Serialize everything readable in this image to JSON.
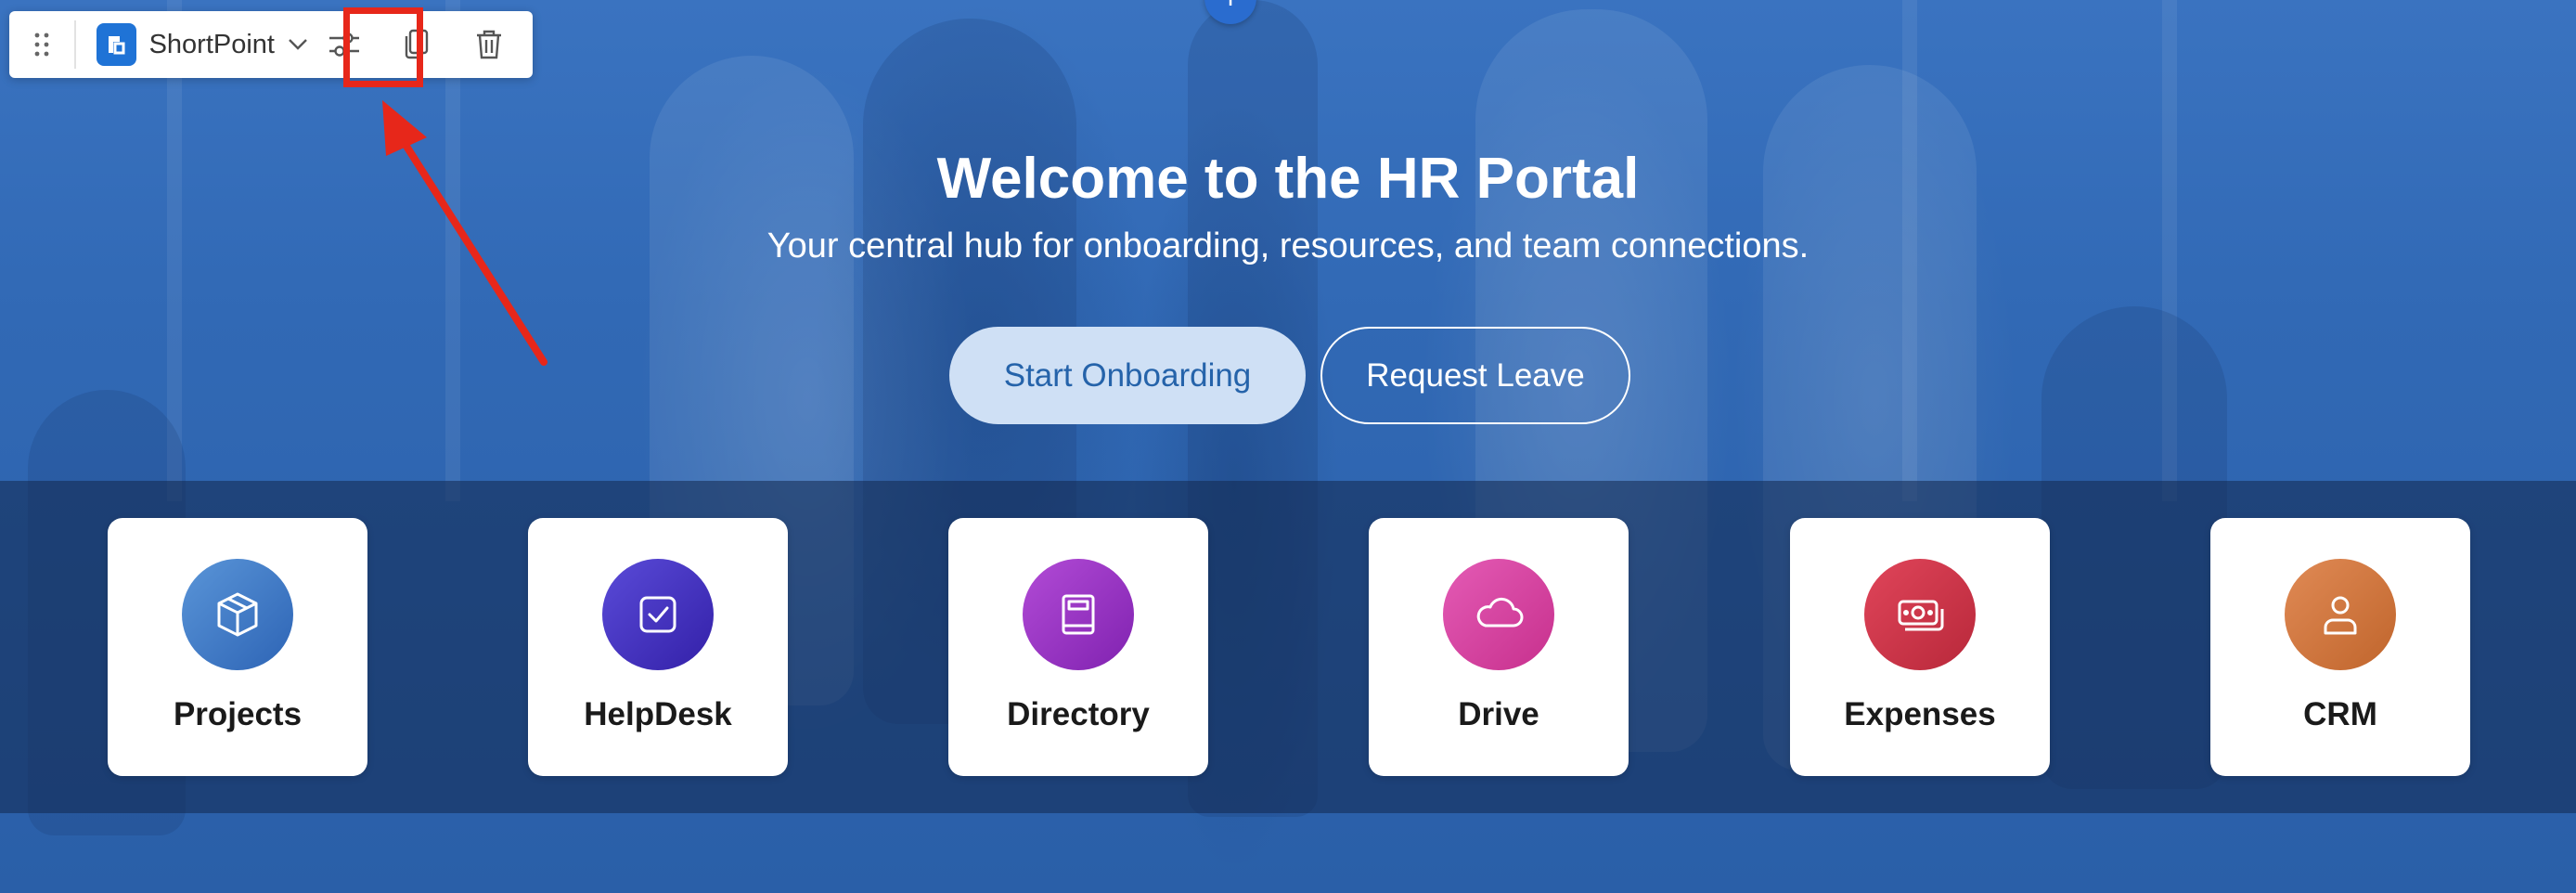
{
  "toolbar": {
    "brand_name": "ShortPoint"
  },
  "hero": {
    "title": "Welcome to the HR Portal",
    "subtitle": "Your central hub for onboarding, resources, and team connections.",
    "primary_button": "Start Onboarding",
    "secondary_button": "Request Leave"
  },
  "tiles": [
    {
      "label": "Projects",
      "icon": "box-icon",
      "color_start": "#5a95d8",
      "color_end": "#2d64b5"
    },
    {
      "label": "HelpDesk",
      "icon": "checkbox-icon",
      "color_start": "#5a4bd8",
      "color_end": "#3320a8"
    },
    {
      "label": "Directory",
      "icon": "book-icon",
      "color_start": "#b24bd6",
      "color_end": "#8022b0"
    },
    {
      "label": "Drive",
      "icon": "cloud-icon",
      "color_start": "#e45bb5",
      "color_end": "#c7308d"
    },
    {
      "label": "Expenses",
      "icon": "money-icon",
      "color_start": "#e0455a",
      "color_end": "#b8283a"
    },
    {
      "label": "CRM",
      "icon": "user-icon",
      "color_start": "#e08a55",
      "color_end": "#c0652c"
    }
  ],
  "colors": {
    "accent": "#1f73d6",
    "highlight": "#e7271a"
  }
}
